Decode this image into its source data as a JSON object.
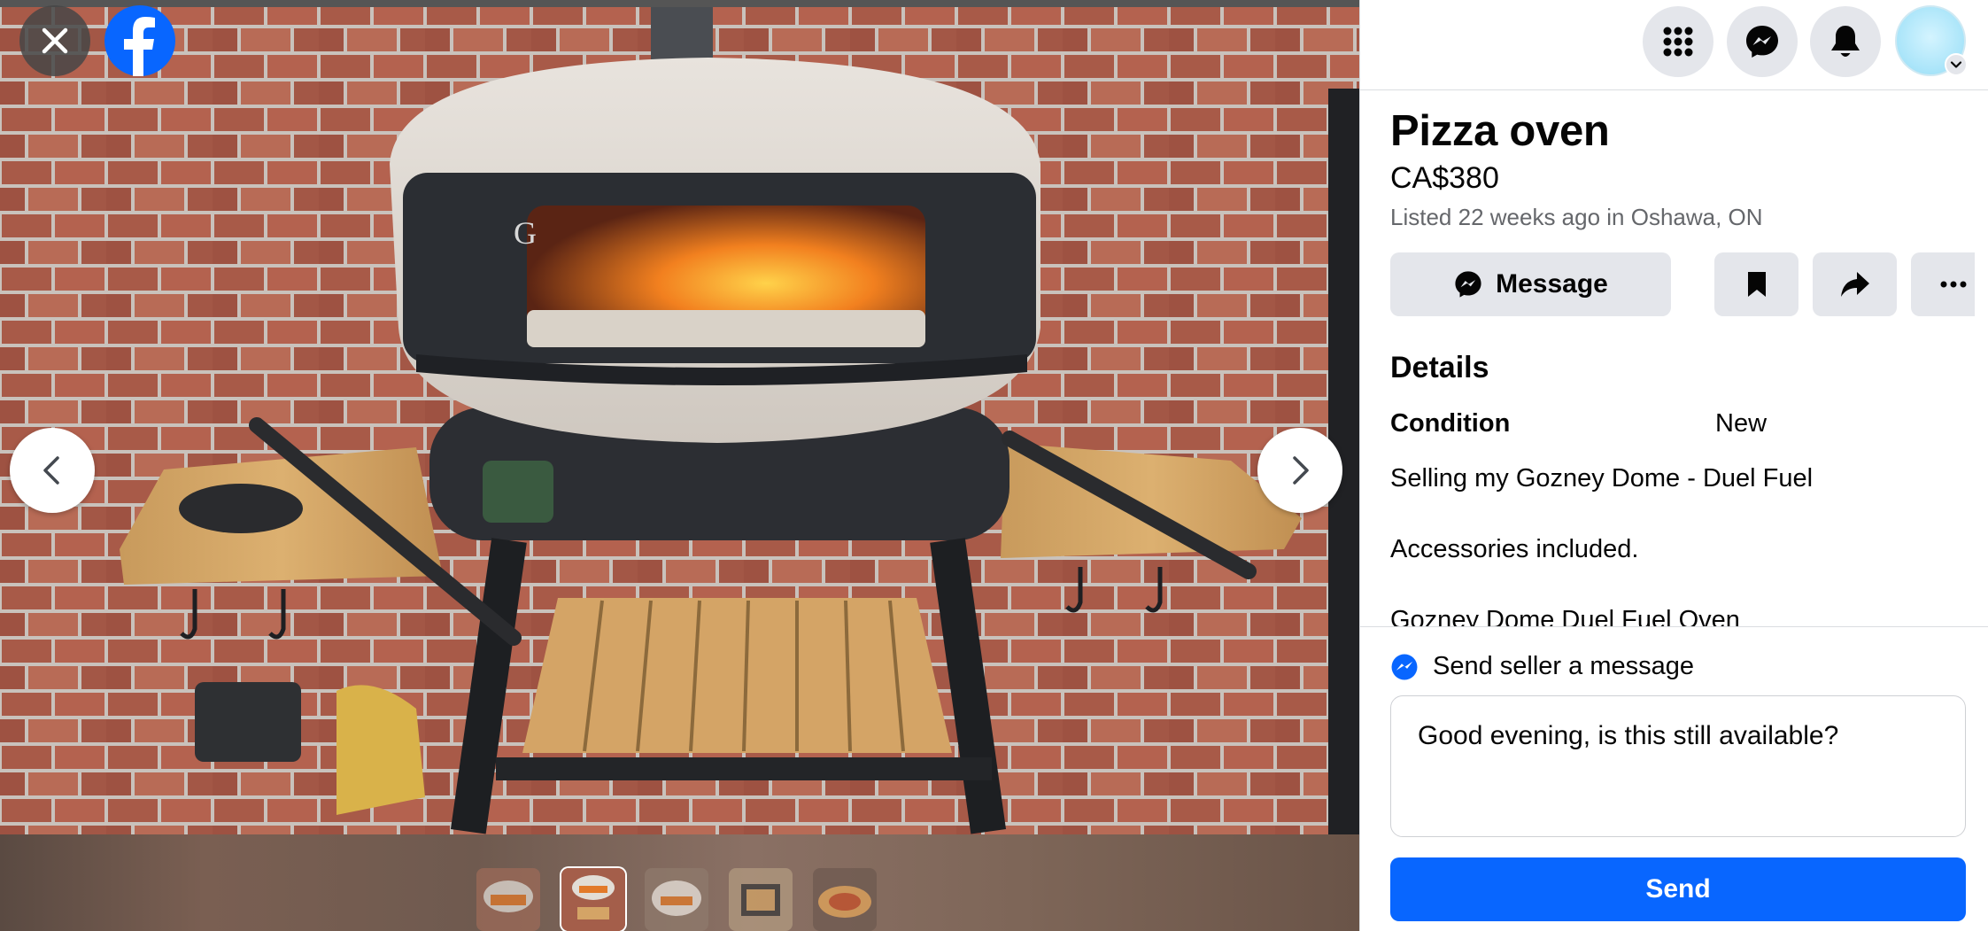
{
  "viewer": {
    "close_icon": "close-icon",
    "logo_icon": "facebook-logo-icon",
    "prev_icon": "chevron-left-icon",
    "next_icon": "chevron-right-icon",
    "thumbnails": [
      {
        "name": "thumbnail-1",
        "active": false
      },
      {
        "name": "thumbnail-2",
        "active": true
      },
      {
        "name": "thumbnail-3",
        "active": false
      },
      {
        "name": "thumbnail-4",
        "active": false
      },
      {
        "name": "thumbnail-5",
        "active": false
      }
    ]
  },
  "topbar": {
    "icons": [
      "menu-grid-icon",
      "messenger-icon",
      "notifications-bell-icon",
      "account-avatar",
      "chevron-down-icon"
    ]
  },
  "listing": {
    "title": "Pizza oven",
    "price": "CA$380",
    "meta": "Listed 22 weeks ago in Oshawa, ON",
    "message_label": "Message",
    "details_heading": "Details",
    "condition_label": "Condition",
    "condition_value": "New",
    "description": [
      "Selling my Gozney Dome - Duel Fuel",
      "Accessories included.",
      "Gozney Dome Duel Fuel Oven"
    ]
  },
  "composer": {
    "heading": "Send seller a message",
    "message_value": "Good evening, is this still available?",
    "send_label": "Send"
  },
  "colors": {
    "brand_blue": "#0866ff",
    "button_gray": "#e4e6eb",
    "secondary_text": "#65676b"
  }
}
